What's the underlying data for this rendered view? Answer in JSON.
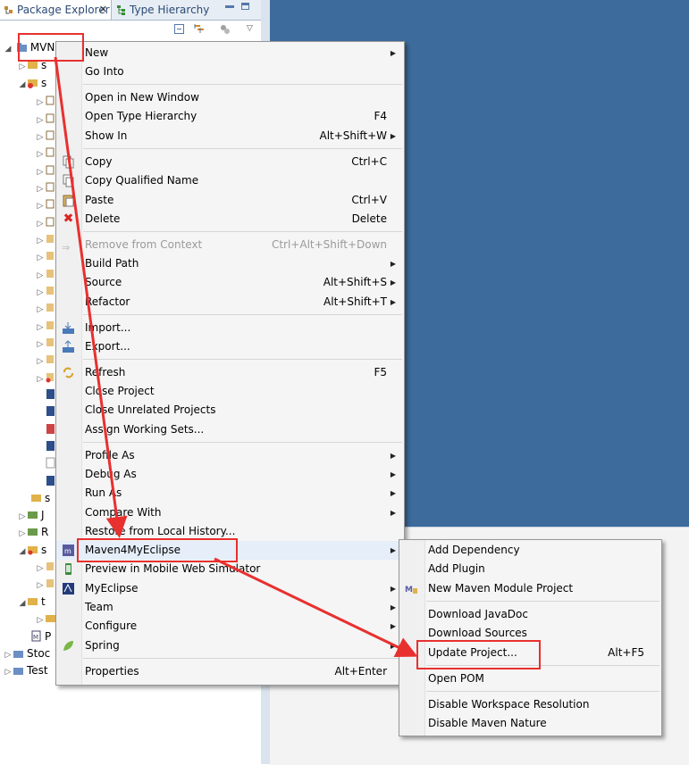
{
  "tabs": {
    "package_explorer": "Package Explorer",
    "type_hierarchy": "Type Hierarchy"
  },
  "tree": {
    "root": "MVN",
    "items": [
      {
        "label": "s"
      },
      {
        "label": "s"
      },
      {
        "label": "s"
      },
      {
        "label": "J"
      },
      {
        "label": "R"
      },
      {
        "label": "s"
      },
      {
        "label": "t"
      },
      {
        "label": "P"
      },
      {
        "label": "Stoc"
      },
      {
        "label": "Test"
      }
    ]
  },
  "context_menu": {
    "items": [
      {
        "label": "New",
        "sub": true
      },
      {
        "label": "Go Into"
      },
      {
        "label": "Open in New Window"
      },
      {
        "label": "Open Type Hierarchy",
        "accel": "F4"
      },
      {
        "label": "Show In",
        "accel": "Alt+Shift+W",
        "sub": true
      },
      {
        "label": "Copy",
        "accel": "Ctrl+C"
      },
      {
        "label": "Copy Qualified Name"
      },
      {
        "label": "Paste",
        "accel": "Ctrl+V"
      },
      {
        "label": "Delete",
        "accel": "Delete"
      },
      {
        "label": "Remove from Context",
        "accel": "Ctrl+Alt+Shift+Down",
        "disabled": true
      },
      {
        "label": "Build Path",
        "sub": true
      },
      {
        "label": "Source",
        "accel": "Alt+Shift+S",
        "sub": true
      },
      {
        "label": "Refactor",
        "accel": "Alt+Shift+T",
        "sub": true
      },
      {
        "label": "Import..."
      },
      {
        "label": "Export..."
      },
      {
        "label": "Refresh",
        "accel": "F5"
      },
      {
        "label": "Close Project"
      },
      {
        "label": "Close Unrelated Projects"
      },
      {
        "label": "Assign Working Sets..."
      },
      {
        "label": "Profile As",
        "sub": true
      },
      {
        "label": "Debug As",
        "sub": true
      },
      {
        "label": "Run As",
        "sub": true
      },
      {
        "label": "Compare With",
        "sub": true
      },
      {
        "label": "Restore from Local History..."
      },
      {
        "label": "Maven4MyEclipse",
        "sub": true
      },
      {
        "label": "Preview in Mobile Web Simulator"
      },
      {
        "label": "MyEclipse",
        "sub": true
      },
      {
        "label": "Team",
        "sub": true
      },
      {
        "label": "Configure",
        "sub": true
      },
      {
        "label": "Spring",
        "sub": true
      },
      {
        "label": "Properties",
        "accel": "Alt+Enter"
      }
    ]
  },
  "submenu": {
    "items": [
      {
        "label": "Add Dependency"
      },
      {
        "label": "Add Plugin"
      },
      {
        "label": "New Maven Module Project"
      },
      {
        "label": "Download JavaDoc"
      },
      {
        "label": "Download Sources"
      },
      {
        "label": "Update Project...",
        "accel": "Alt+F5"
      },
      {
        "label": "Open POM"
      },
      {
        "label": "Disable Workspace Resolution"
      },
      {
        "label": "Disable Maven Nature"
      }
    ]
  },
  "colors": {
    "editor_bg": "#3d6b9c",
    "annotation_red": "#e8302f"
  }
}
